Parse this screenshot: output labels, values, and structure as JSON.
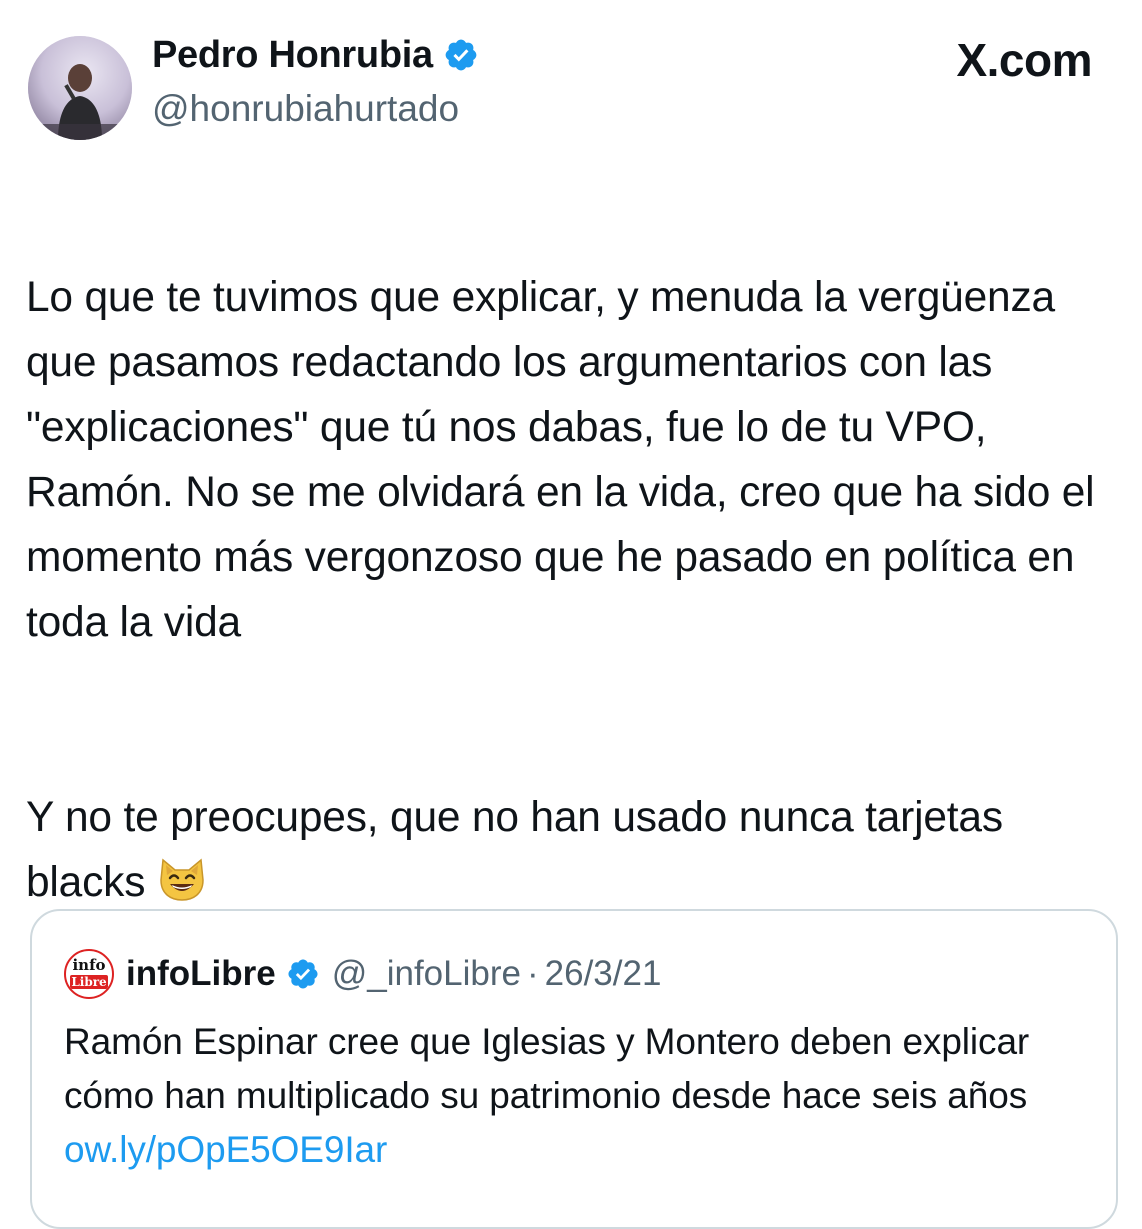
{
  "site": {
    "label": "X.com"
  },
  "author": {
    "display_name": "Pedro Honrubia",
    "handle": "@honrubiahurtado",
    "verified": true,
    "verified_color": "#1d9bf0"
  },
  "tweet": {
    "paragraphs": [
      "Lo que te tuvimos que explicar, y menuda la vergüenza que pasamos redactando los argumentarios con las \"explicaciones\" que tú nos dabas, fue lo de tu VPO, Ramón. No se me olvidará en la vida, creo que ha sido el momento más vergonzoso que he pasado en política en toda la vida",
      "Y no te preocupes, que no han usado nunca tarjetas blacks"
    ],
    "trailing_emoji": "grinning-cat-icon"
  },
  "quoted": {
    "logo_top": "info",
    "logo_bottom": "Libre",
    "name": "infoLibre",
    "handle": "@_infoLibre",
    "separator": "·",
    "date": "26/3/21",
    "text": "Ramón Espinar cree que Iglesias y Montero deben explicar cómo han multiplicado su patrimonio desde hace seis años ",
    "link_text": "ow.ly/pOpE5OE9Iar",
    "link_color": "#1d9bf0"
  }
}
